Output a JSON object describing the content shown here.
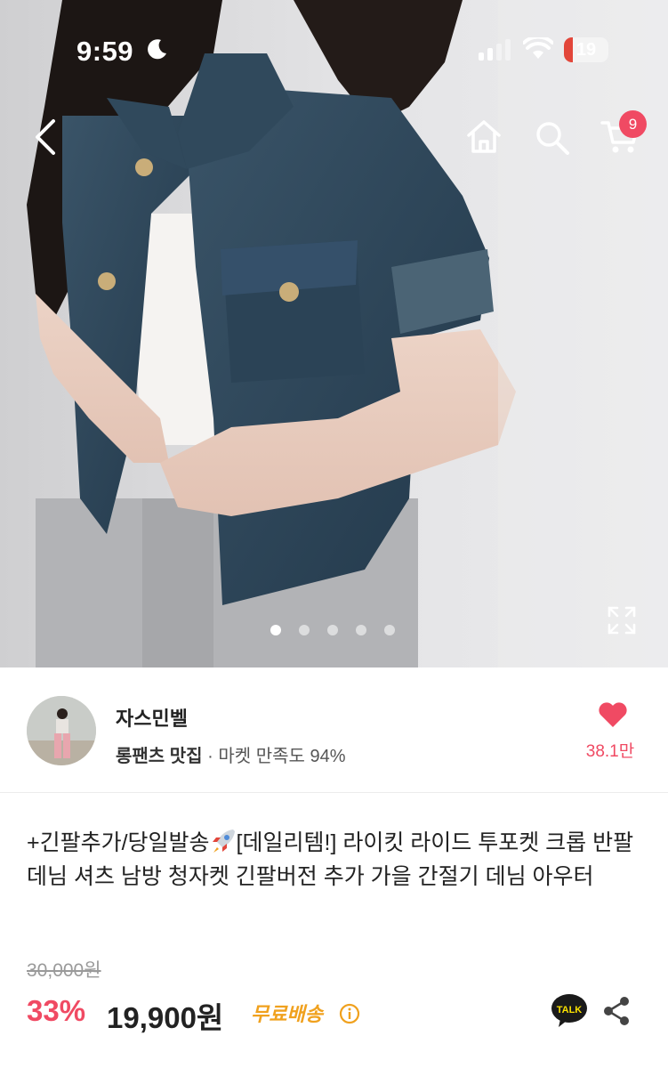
{
  "status_bar": {
    "time": "9:59",
    "battery": "19"
  },
  "nav": {
    "cart_count": "9"
  },
  "gallery": {
    "total_images": 5,
    "current_index": 1
  },
  "seller": {
    "name": "자스민벨",
    "tag": "롱팬츠 맛집",
    "satisfaction": "· 마켓 만족도 94%",
    "likes": "38.1만"
  },
  "product": {
    "title_part1": "+긴팔추가/당일발송",
    "title_part2": "[데일리템!] 라이킷 라이드 투포켓 크롭 반팔 데님 셔츠 남방 청자켓 긴팔버전 추가 가을 간절기 데님 아우터",
    "original_price": "30,000원",
    "discount": "33%",
    "price": "19,900원",
    "shipping": "무료배송",
    "talk_label": "TALK"
  },
  "colors": {
    "accent": "#f04a63",
    "shipping": "#f0a11e",
    "denim": "#2e4457"
  }
}
